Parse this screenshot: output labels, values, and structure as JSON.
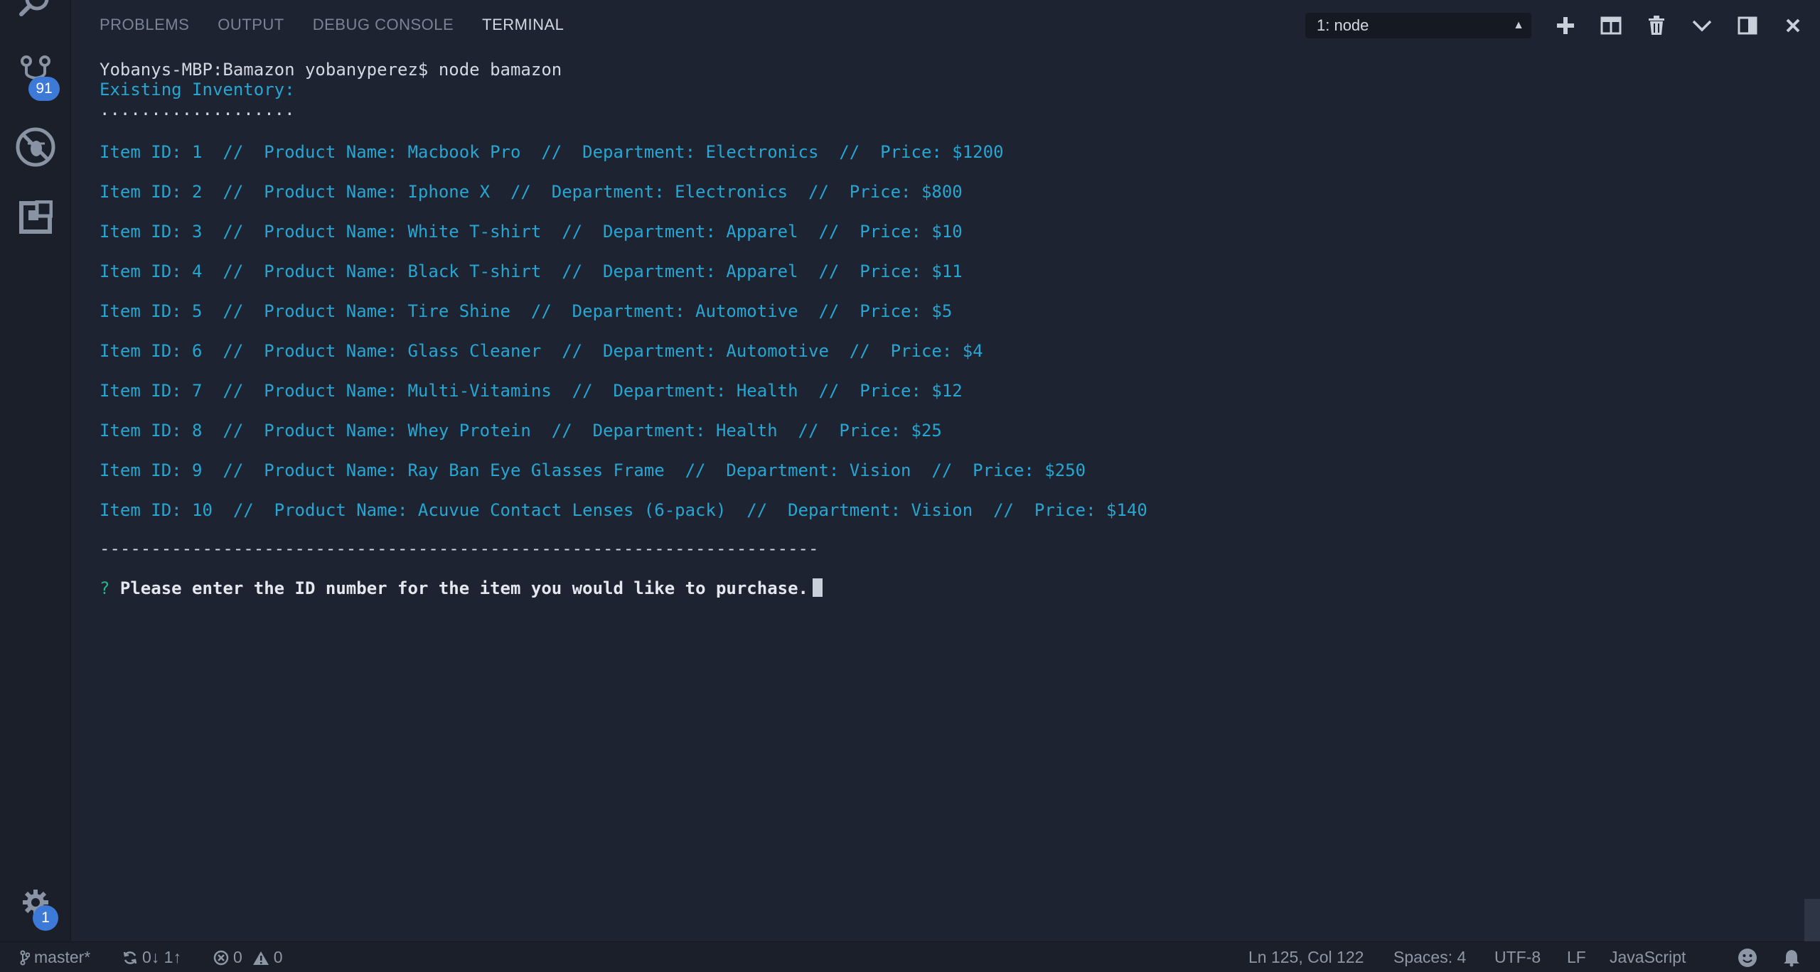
{
  "activity": {
    "scm_badge": "91",
    "settings_badge": "1"
  },
  "panel": {
    "tabs": [
      {
        "label": "PROBLEMS"
      },
      {
        "label": "OUTPUT"
      },
      {
        "label": "DEBUG CONSOLE"
      },
      {
        "label": "TERMINAL"
      }
    ],
    "active_tab": "TERMINAL",
    "terminal_selector": "1: node"
  },
  "terminal": {
    "command_line": "Yobanys-MBP:Bamazon yobanyperez$ node bamazon",
    "heading": "Existing Inventory:",
    "dots": "...................",
    "items": [
      "Item ID: 1  //  Product Name: Macbook Pro  //  Department: Electronics  //  Price: $1200",
      "Item ID: 2  //  Product Name: Iphone X  //  Department: Electronics  //  Price: $800",
      "Item ID: 3  //  Product Name: White T-shirt  //  Department: Apparel  //  Price: $10",
      "Item ID: 4  //  Product Name: Black T-shirt  //  Department: Apparel  //  Price: $11",
      "Item ID: 5  //  Product Name: Tire Shine  //  Department: Automotive  //  Price: $5",
      "Item ID: 6  //  Product Name: Glass Cleaner  //  Department: Automotive  //  Price: $4",
      "Item ID: 7  //  Product Name: Multi-Vitamins  //  Department: Health  //  Price: $12",
      "Item ID: 8  //  Product Name: Whey Protein  //  Department: Health  //  Price: $25",
      "Item ID: 9  //  Product Name: Ray Ban Eye Glasses Frame  //  Department: Vision  //  Price: $250",
      "Item ID: 10  //  Product Name: Acuvue Contact Lenses (6-pack)  //  Department: Vision  //  Price: $140"
    ],
    "divider": "----------------------------------------------------------------------",
    "prompt_marker": "?",
    "prompt_text": "Please enter the ID number for the item you would like to purchase."
  },
  "status_bar": {
    "branch": "master*",
    "sync": "0↓ 1↑",
    "errors": "0",
    "warnings": "0",
    "cursor_position": "Ln 125, Col 122",
    "indentation": "Spaces: 4",
    "encoding": "UTF-8",
    "line_ending": "LF",
    "language": "JavaScript"
  },
  "colors": {
    "background": "#1d2330",
    "terminal_cyan": "#27a6d3",
    "badge_blue": "#3d7ad8"
  }
}
